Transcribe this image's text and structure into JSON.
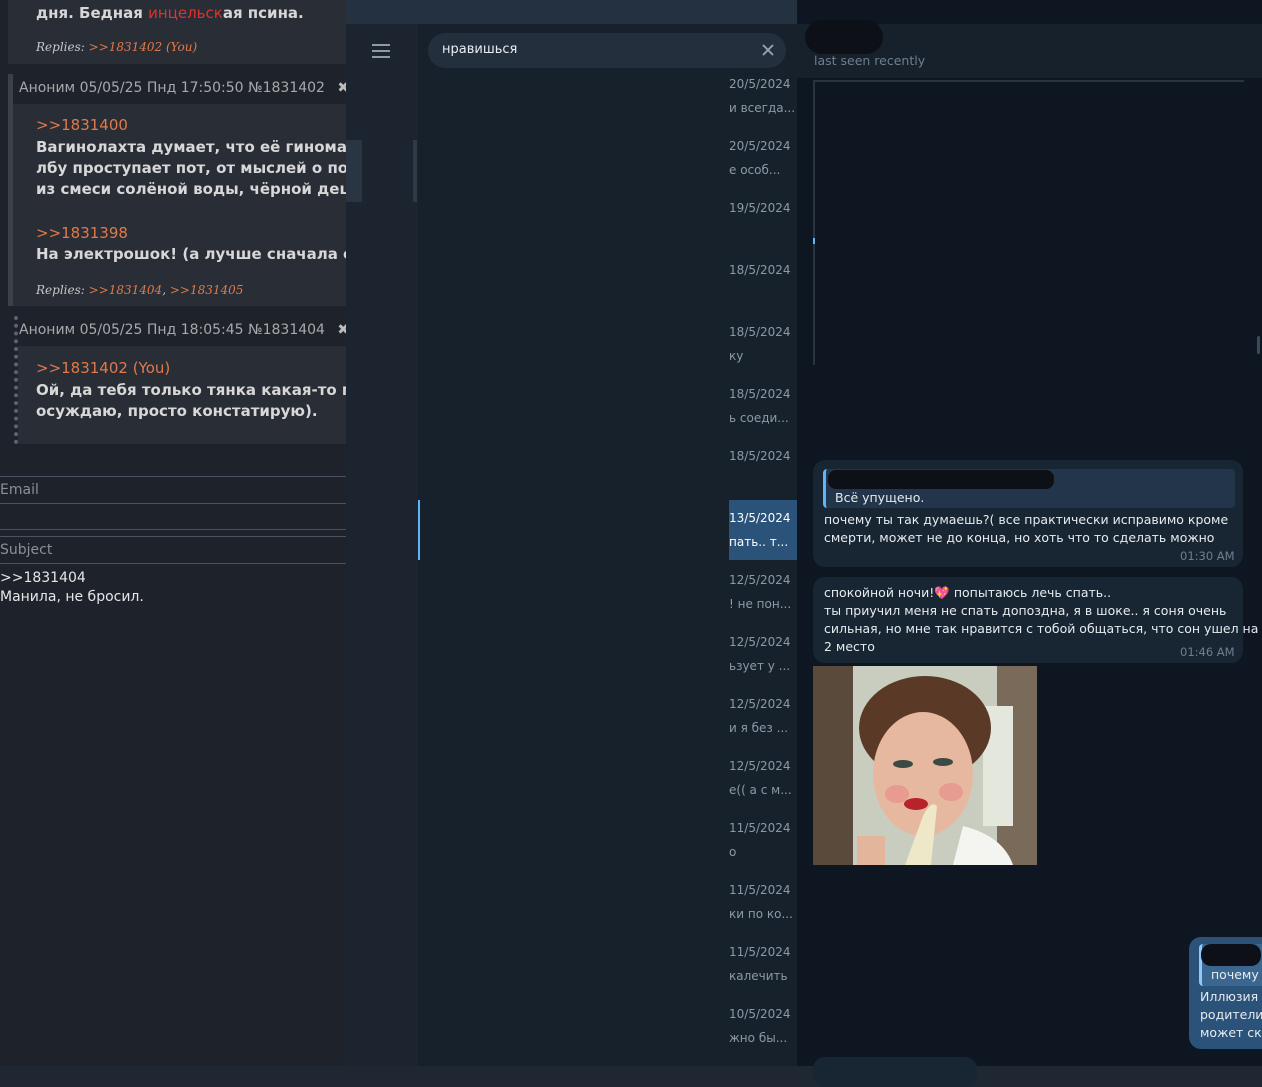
{
  "board": {
    "top_line": {
      "before": "дня. Бедная ",
      "highlight": "инцельск",
      "after": "ая псина."
    },
    "top_replies": {
      "label": "Replies:",
      "ref": ">>1831402 (You)"
    },
    "post1": {
      "author": "Аноним",
      "date": "05/05/25 Пнд 17:50:50",
      "num": "№1831402",
      "quote1": ">>1831400",
      "lines1": [
        "Вагинолахта думает, что её гиноматриар",
        "лбу проступает пот, от мыслей о потери",
        "из смеси солёной воды, чёрной дешёвой"
      ],
      "quote2": ">>1831398",
      "line2": "На электрошок! (а лучше сначала смени",
      "replies_label": "Replies:",
      "reply_refs": [
        ">>1831404",
        ">>1831405"
      ]
    },
    "post2": {
      "author": "Аноним",
      "date": "05/05/25 Пнд 18:05:45",
      "num": "№1831404",
      "quote": ">>1831402 (You)",
      "lines": [
        "Ой, да тебя только тянка какая-то помак",
        "осуждаю, просто констатирую)."
      ]
    },
    "form": {
      "email": "Email",
      "subject": "Subject",
      "body_lines": [
        ">>1831404",
        "Манила, не бросил."
      ]
    },
    "icons": {
      "close": "✖",
      "play": "▶"
    }
  },
  "telegram": {
    "search": {
      "query": "нравишься",
      "clear_icon": "close-icon"
    },
    "status": "last seen recently",
    "results": [
      {
        "date": "20/5/2024",
        "snippet": "и всегда..."
      },
      {
        "date": "20/5/2024",
        "snippet": "е особ..."
      },
      {
        "date": "19/5/2024",
        "snippet": ""
      },
      {
        "date": "18/5/2024",
        "snippet": ""
      },
      {
        "date": "18/5/2024",
        "snippet": "ку"
      },
      {
        "date": "18/5/2024",
        "snippet": "ь соеди..."
      },
      {
        "date": "18/5/2024",
        "snippet": ""
      },
      {
        "date": "13/5/2024",
        "snippet": "пать.. т...",
        "selected": true
      },
      {
        "date": "12/5/2024",
        "snippet": "! не пон..."
      },
      {
        "date": "12/5/2024",
        "snippet": "ьзует у ..."
      },
      {
        "date": "12/5/2024",
        "snippet": "и я без ..."
      },
      {
        "date": "12/5/2024",
        "snippet": "е(( а с м..."
      },
      {
        "date": "11/5/2024",
        "snippet": "о"
      },
      {
        "date": "11/5/2024",
        "snippet": "ки по ко..."
      },
      {
        "date": "11/5/2024",
        "snippet": "калечить"
      },
      {
        "date": "10/5/2024",
        "snippet": "жно бы..."
      }
    ],
    "messages": {
      "m1": {
        "reply_text": "Всё упущено.",
        "lines": [
          "почему ты так думаешь?( все практически исправимо кроме",
          "смерти, может не до конца, но хоть что то сделать можно"
        ],
        "time": "01:30 AM"
      },
      "m2": {
        "first_before": "спокойной ночи!",
        "emoji": "💖",
        "first_after": " попытаюсь лечь спать..",
        "lines": [
          "ты приучил меня не спать допоздна, я в шоке.. я соня очень",
          "сильная, но мне так нравится с тобой общаться, что сон ушел на",
          "2 место"
        ],
        "time": "01:46 AM"
      },
      "m3": {
        "reply_text": "почему",
        "lines": [
          "Иллюзия н",
          "родители",
          "может ска"
        ]
      }
    },
    "colors": {
      "accent": "#5eb5f7",
      "outgoing": "#2b5278",
      "incoming": "#182533"
    }
  }
}
